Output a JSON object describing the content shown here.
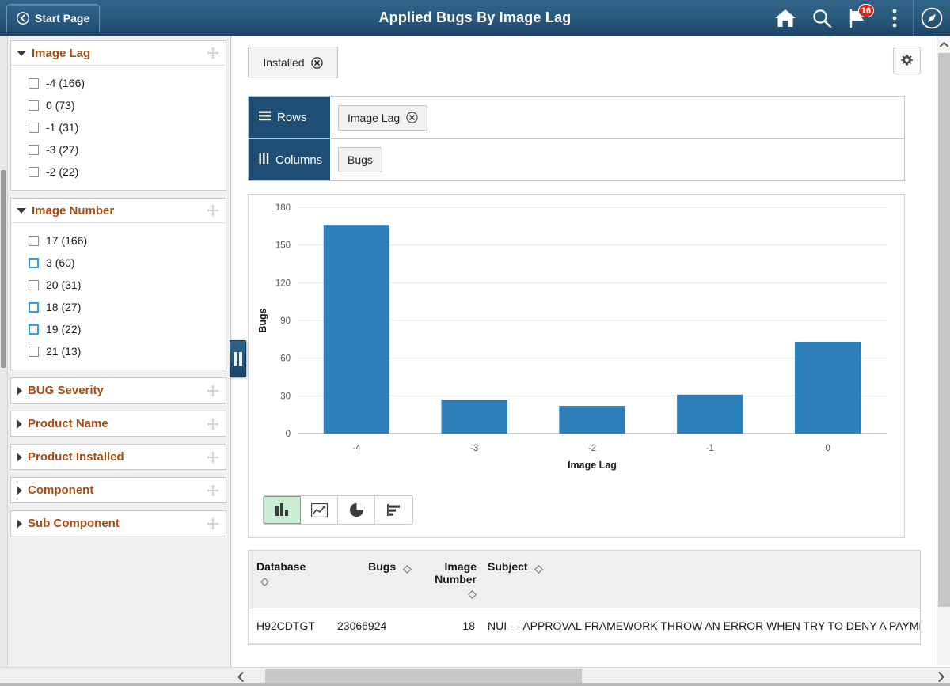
{
  "header": {
    "back_label": "Start Page",
    "title": "Applied Bugs By Image Lag",
    "icons": {
      "home": "home-icon",
      "search": "search-icon",
      "notifications": "flag-icon",
      "notification_count": "16",
      "actions": "kebab-menu-icon",
      "navbar": "compass-icon"
    },
    "colors": {
      "background_top": "#2f6489",
      "background_bottom": "#1d4568",
      "badge": "#d8261c"
    }
  },
  "sidebar": {
    "facets": [
      {
        "title": "Image Lag",
        "expanded": true,
        "items": [
          {
            "label": "-4 (166)",
            "checked": false,
            "highlight": false
          },
          {
            "label": "0 (73)",
            "checked": false,
            "highlight": false
          },
          {
            "label": "-1 (31)",
            "checked": false,
            "highlight": false
          },
          {
            "label": "-3 (27)",
            "checked": false,
            "highlight": false
          },
          {
            "label": "-2 (22)",
            "checked": false,
            "highlight": false
          }
        ]
      },
      {
        "title": "Image Number",
        "expanded": true,
        "items": [
          {
            "label": "17 (166)",
            "checked": false,
            "highlight": false
          },
          {
            "label": "3 (60)",
            "checked": false,
            "highlight": true
          },
          {
            "label": "20 (31)",
            "checked": false,
            "highlight": false
          },
          {
            "label": "18 (27)",
            "checked": false,
            "highlight": true
          },
          {
            "label": "19 (22)",
            "checked": false,
            "highlight": true
          },
          {
            "label": "21 (13)",
            "checked": false,
            "highlight": false
          }
        ]
      },
      {
        "title": "BUG Severity",
        "expanded": false,
        "items": []
      },
      {
        "title": "Product Name",
        "expanded": false,
        "items": []
      },
      {
        "title": "Product Installed",
        "expanded": false,
        "items": []
      },
      {
        "title": "Component",
        "expanded": false,
        "items": []
      },
      {
        "title": "Sub Component",
        "expanded": false,
        "items": []
      }
    ],
    "colors": {
      "facet_title": "#a84b12"
    }
  },
  "main": {
    "filter_chip": "Installed",
    "settings_icon": "gear-icon",
    "shelves": [
      {
        "label": "Rows",
        "icon": "rows-icon",
        "pills": [
          {
            "label": "Image Lag",
            "removable": true
          }
        ]
      },
      {
        "label": "Columns",
        "icon": "columns-icon",
        "pills": [
          {
            "label": "Bugs",
            "removable": false
          }
        ]
      }
    ],
    "chart_types": [
      {
        "name": "bar-chart-icon",
        "active": true
      },
      {
        "name": "line-chart-icon",
        "active": false
      },
      {
        "name": "pie-chart-icon",
        "active": false
      },
      {
        "name": "horizontal-bar-chart-icon",
        "active": false
      }
    ],
    "table": {
      "columns": [
        {
          "label": "Database",
          "sortable": true
        },
        {
          "label": "Bugs",
          "sortable": true
        },
        {
          "label": "Image Number",
          "sortable": true
        },
        {
          "label": "Subject",
          "sortable": true
        }
      ],
      "rows": [
        {
          "database": "H92CDTGT",
          "bugs": "23066924",
          "image_number": "18",
          "subject": "NUI - - APPROVAL FRAMEWORK THROW AN ERROR WHEN TRY TO DENY A PAYMENT"
        }
      ]
    }
  },
  "chart_data": {
    "type": "bar",
    "title": "",
    "categories": [
      "-4",
      "-3",
      "-2",
      "-1",
      "0"
    ],
    "values": [
      166,
      27,
      22,
      31,
      73
    ],
    "series": [
      {
        "name": "Bugs",
        "values": [
          166,
          27,
          22,
          31,
          73
        ]
      }
    ],
    "xlabel": "Image Lag",
    "ylabel": "Bugs",
    "ylim": [
      0,
      180
    ],
    "yticks": [
      0,
      30,
      60,
      90,
      120,
      150,
      180
    ],
    "grid": true,
    "legend": "none",
    "bar_color": "#2c7fb8"
  },
  "scrollbars": {
    "bottom_left_arrow": "chevron-left-icon",
    "bottom_right_arrow": "chevron-right-icon",
    "vertical_up_arrow": "chevron-up-icon"
  }
}
